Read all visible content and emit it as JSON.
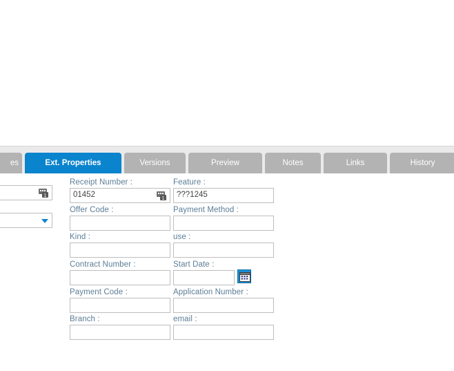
{
  "tabs": [
    {
      "label": "es",
      "name": "tab-properties-clipped",
      "active": false
    },
    {
      "label": "Ext. Properties",
      "name": "tab-ext-properties",
      "active": true
    },
    {
      "label": "Versions",
      "name": "tab-versions",
      "active": false
    },
    {
      "label": "Preview",
      "name": "tab-preview",
      "active": false
    },
    {
      "label": "Notes",
      "name": "tab-notes",
      "active": false
    },
    {
      "label": "Links",
      "name": "tab-links",
      "active": false
    },
    {
      "label": "History",
      "name": "tab-history",
      "active": false
    }
  ],
  "form": {
    "fields": {
      "receipt_number": {
        "label": "Receipt Number :",
        "value": "01452",
        "placeholder": ""
      },
      "feature": {
        "label": "Feature :",
        "value": "???1245",
        "placeholder": ""
      },
      "offer_code": {
        "label": "Offer Code :",
        "value": "",
        "placeholder": ""
      },
      "payment_method": {
        "label": "Payment Method :",
        "value": "",
        "placeholder": ""
      },
      "kind": {
        "label": "Kind :",
        "value": "",
        "placeholder": ""
      },
      "use": {
        "label": "use :",
        "value": "",
        "placeholder": ""
      },
      "contract_number": {
        "label": "Contract Number :",
        "value": "",
        "placeholder": ""
      },
      "start_date": {
        "label": "Start Date :",
        "value": "",
        "placeholder": ""
      },
      "payment_code": {
        "label": "Payment Code :",
        "value": "",
        "placeholder": ""
      },
      "application_number": {
        "label": "Application Number :",
        "value": "",
        "placeholder": ""
      },
      "branch": {
        "label": "Branch :",
        "value": "",
        "placeholder": ""
      },
      "email": {
        "label": "email :",
        "value": "",
        "placeholder": ""
      }
    },
    "clipped_left": {
      "input_value": "",
      "select_value": ""
    }
  },
  "colors": {
    "active_tab": "#0b84ce",
    "inactive_tab": "#b3b3b3",
    "tab_strip_bg": "#eaeaea",
    "label_text": "#5c7d96",
    "field_border": "#bdbdbd",
    "accent": "#1a8fd4"
  }
}
